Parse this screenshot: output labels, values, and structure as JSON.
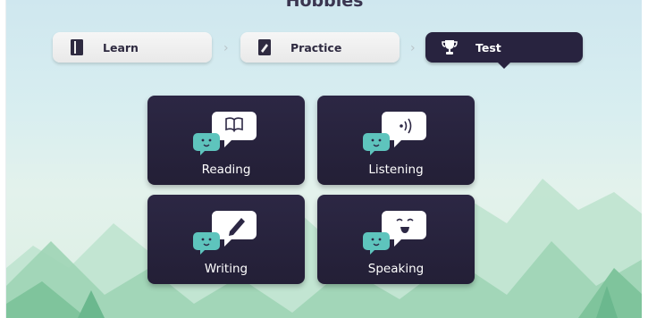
{
  "page": {
    "title": "Hobbies"
  },
  "stepper": {
    "steps": [
      {
        "label": "Learn",
        "icon": "book-icon",
        "state": "inactive"
      },
      {
        "label": "Practice",
        "icon": "worksheet-pencil-icon",
        "state": "inactive"
      },
      {
        "label": "Test",
        "icon": "trophy-icon",
        "state": "active"
      }
    ]
  },
  "skills": [
    {
      "label": "Reading",
      "icon": "open-book-icon"
    },
    {
      "label": "Listening",
      "icon": "sound-waves-icon"
    },
    {
      "label": "Writing",
      "icon": "pencil-icon"
    },
    {
      "label": "Speaking",
      "icon": "smiling-face-icon"
    }
  ],
  "colors": {
    "card_bg": "#28233f",
    "active_step_bg": "#28233f",
    "inactive_step_bg": "#efefef",
    "bubble_teal": "#5ec4bd",
    "bubble_white": "#ffffff",
    "sky": "#cfe7ef",
    "mountain": "#9fd2b8"
  }
}
